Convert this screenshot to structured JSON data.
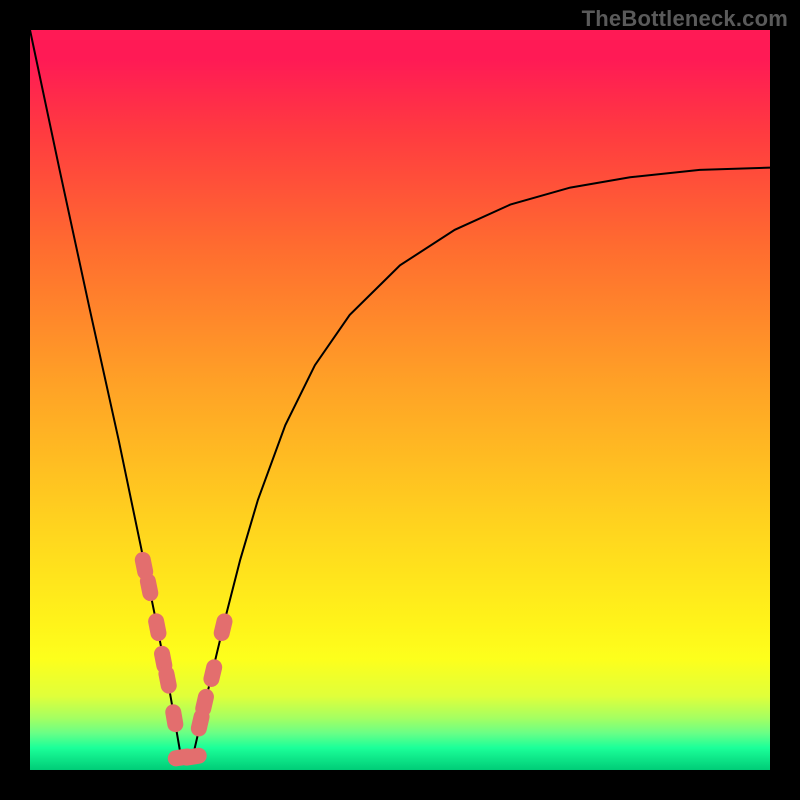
{
  "attribution": "TheBottleneck.com",
  "colors": {
    "marker": "#e36e6e",
    "curve": "#000000"
  },
  "chart_data": {
    "type": "line",
    "title": "",
    "xlabel": "",
    "ylabel": "",
    "xlim": [
      0,
      100
    ],
    "ylim": [
      0,
      100
    ],
    "note": "V-shaped curve with minimum near x≈20; axes unlabeled; values estimated from pixel positions within the 740×740 gradient plot area (x right, y up).",
    "series": [
      {
        "name": "curve",
        "x": [
          0,
          4,
          8,
          12,
          15,
          17,
          18.8,
          20.3,
          22.2,
          24.3,
          26.4,
          28.4,
          30.8,
          34.5,
          38.5,
          43.2,
          50,
          57.4,
          64.9,
          73,
          81.1,
          90.5,
          100
        ],
        "y": [
          100,
          81.1,
          62.6,
          44.5,
          30.1,
          20.3,
          11.1,
          2.4,
          2.7,
          11.8,
          20.6,
          28.4,
          36.5,
          46.6,
          54.7,
          61.5,
          68.2,
          73,
          76.4,
          78.7,
          80.1,
          81.1,
          81.4
        ]
      }
    ],
    "markers": {
      "name": "highlighted-points",
      "x": [
        15.4,
        16.1,
        17.2,
        18,
        18.6,
        19.5,
        20.5,
        22,
        23,
        23.6,
        24.7,
        26.1
      ],
      "y": [
        27.6,
        24.7,
        19.3,
        14.9,
        12.2,
        7,
        1.7,
        1.8,
        6.4,
        9.1,
        13.1,
        19.3
      ]
    }
  }
}
